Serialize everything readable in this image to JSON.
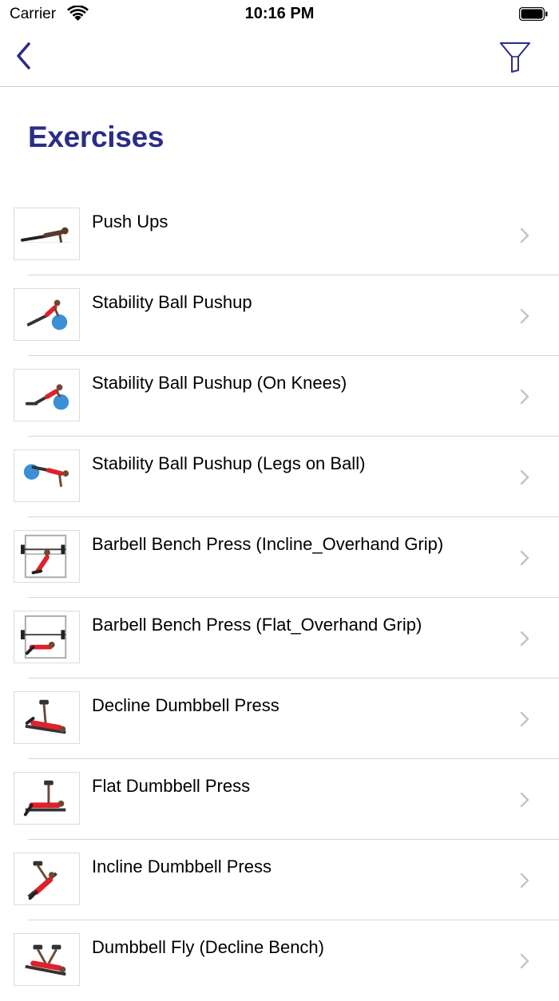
{
  "status_bar": {
    "carrier": "Carrier",
    "time": "10:16 PM",
    "icons": [
      "wifi-icon",
      "battery-icon"
    ]
  },
  "nav": {
    "back_icon": "chevron-left-icon",
    "filter_icon": "filter-funnel-icon",
    "accent_color": "#2b2d86"
  },
  "page": {
    "title": "Exercises"
  },
  "exercises": [
    {
      "label": "Push Ups",
      "thumbnail": "pushup-figure"
    },
    {
      "label": "Stability Ball Pushup",
      "thumbnail": "ball-pushup-figure"
    },
    {
      "label": "Stability Ball Pushup (On Knees)",
      "thumbnail": "ball-pushup-knees-figure"
    },
    {
      "label": "Stability Ball Pushup (Legs on Ball)",
      "thumbnail": "ball-pushup-legs-figure"
    },
    {
      "label": "Barbell Bench Press (Incline_Overhand Grip)",
      "thumbnail": "incline-barbell-rack-figure"
    },
    {
      "label": "Barbell Bench Press (Flat_Overhand Grip)",
      "thumbnail": "flat-barbell-rack-figure"
    },
    {
      "label": "Decline Dumbbell Press",
      "thumbnail": "decline-dumbbell-figure"
    },
    {
      "label": "Flat Dumbbell Press",
      "thumbnail": "flat-dumbbell-figure"
    },
    {
      "label": "Incline Dumbbell Press",
      "thumbnail": "incline-dumbbell-figure"
    },
    {
      "label": "Dumbbell Fly (Decline Bench)",
      "thumbnail": "dumbbell-fly-figure"
    }
  ]
}
